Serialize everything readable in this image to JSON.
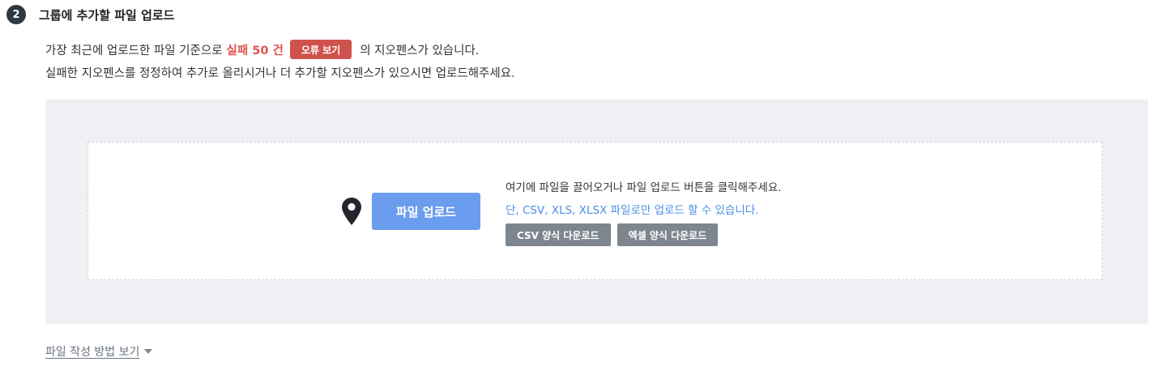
{
  "section": {
    "step_number": "2",
    "title": "그룹에 추가할 파일 업로드"
  },
  "description": {
    "line1_prefix": "가장 최근에 업로드한 파일 기준으로",
    "fail_text": "실패 50 건",
    "error_button_label": "오류 보기",
    "line1_suffix": "의 지오펜스가 있습니다.",
    "line2": "실패한 지오펜스를 정정하여 추가로 올리시거나 더 추가할 지오펜스가 있으시면 업로드해주세요."
  },
  "upload": {
    "button_label": "파일 업로드",
    "hint": "여기에 파일을 끌어오거나 파일 업로드 버튼을 클릭해주세요.",
    "formats_note": "단, CSV, XLS, XLSX 파일로만 업로드 할 수 있습니다.",
    "csv_template_label": "CSV 양식 다운로드",
    "excel_template_label": "엑셀 양식 다운로드",
    "icon": "map-pin-icon"
  },
  "guide": {
    "label": "파일 작성 방법 보기",
    "icon": "caret-down-icon"
  },
  "colors": {
    "accent_blue": "#6a9ded",
    "error_red": "#cf534c",
    "fail_text_red": "#e0544d",
    "formats_blue": "#4a8fe6",
    "template_gray": "#7d858f",
    "area_bg": "#eef0f3"
  }
}
